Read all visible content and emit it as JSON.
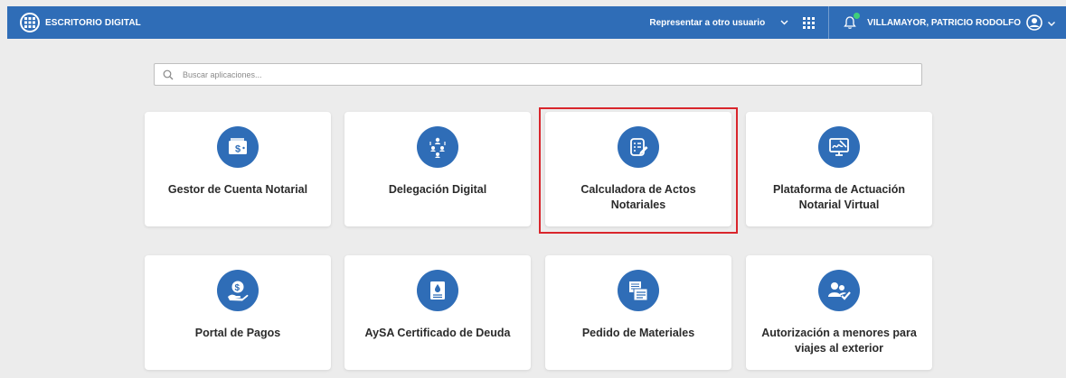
{
  "header": {
    "app_title": "ESCRITORIO DIGITAL",
    "represent_label": "Representar a otro usuario",
    "user_name": "VILLAMAYOR, PATRICIO RODOLFO"
  },
  "search": {
    "placeholder": "Buscar aplicaciones..."
  },
  "apps": [
    {
      "title": "Gestor de Cuenta Notarial",
      "icon": "wallet-dollar-icon"
    },
    {
      "title": "Delegación Digital",
      "icon": "delegation-people-icon"
    },
    {
      "title": "Calculadora de Actos Notariales",
      "icon": "document-edit-icon",
      "selected": true
    },
    {
      "title": "Plataforma de Actuación Notarial Virtual",
      "icon": "monitor-signature-icon"
    },
    {
      "title": "Portal de Pagos",
      "icon": "hand-coin-icon"
    },
    {
      "title": "AySA Certificado de Deuda",
      "icon": "water-document-icon"
    },
    {
      "title": "Pedido de Materiales",
      "icon": "documents-list-icon"
    },
    {
      "title": "Autorización a menores para viajes al exterior",
      "icon": "users-check-icon"
    }
  ],
  "colors": {
    "header": "#2f6db7",
    "accent": "#2f6db7",
    "selection": "#d9262c",
    "background": "#ececec"
  }
}
